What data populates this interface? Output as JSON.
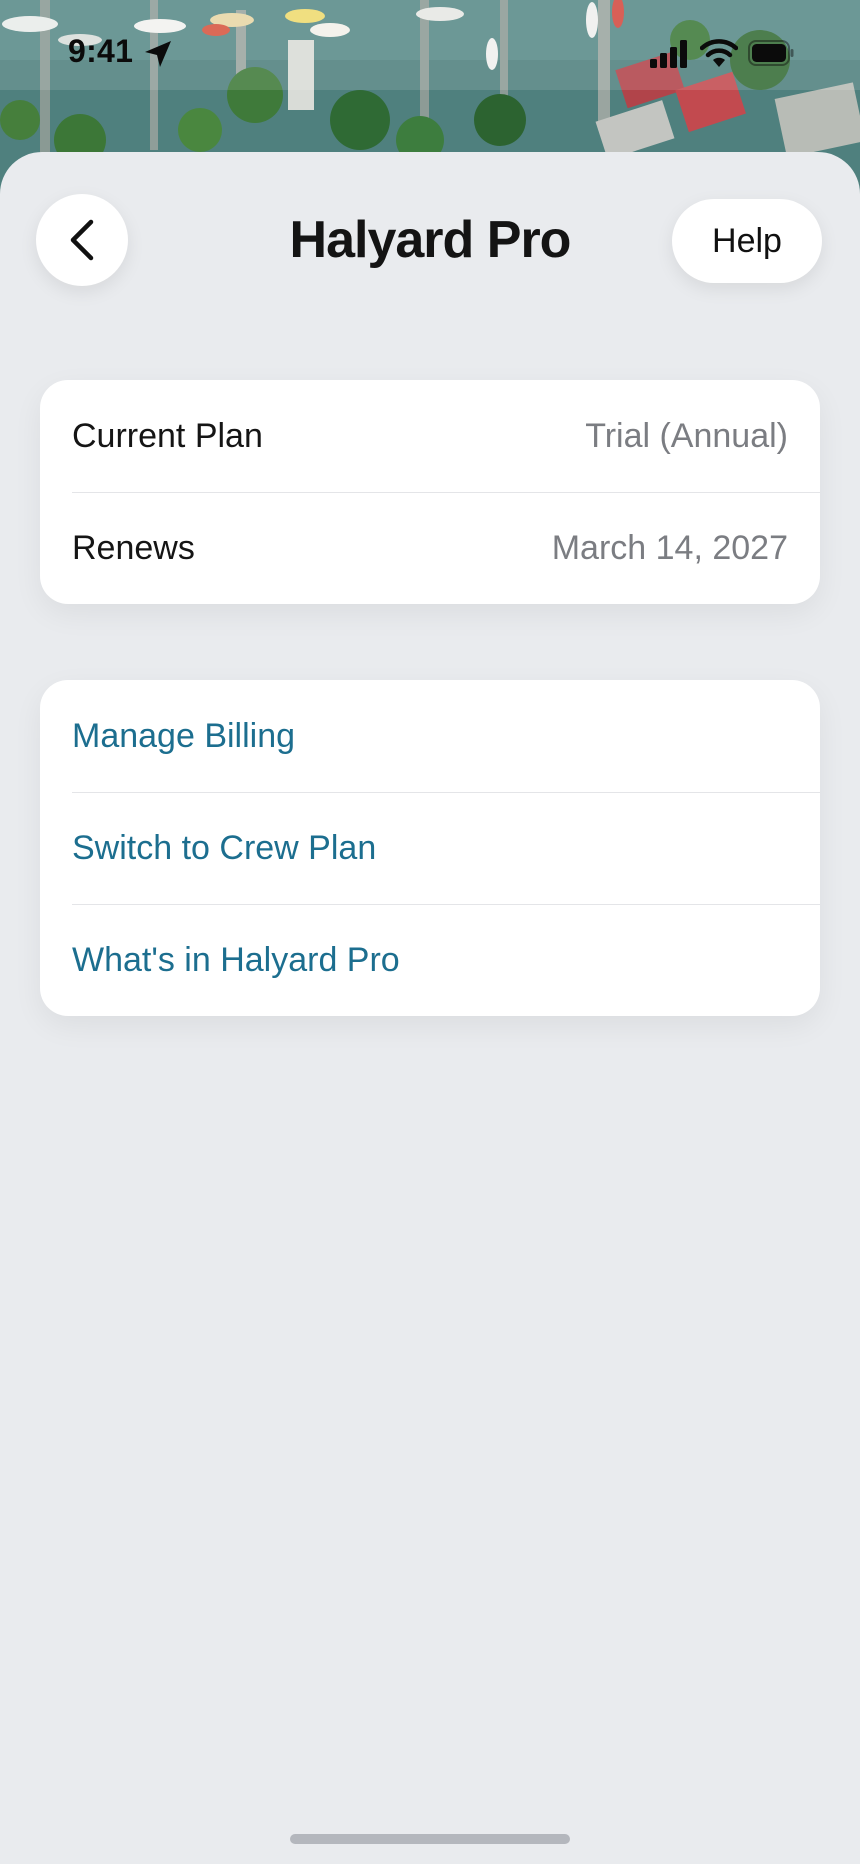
{
  "status_bar": {
    "time": "9:41",
    "icons": [
      "location-arrow-icon",
      "cellular-signal-icon",
      "wifi-icon",
      "battery-icon"
    ]
  },
  "header": {
    "title": "Halyard Pro",
    "back_icon": "chevron-left-icon",
    "help_label": "Help"
  },
  "plan": {
    "rows": [
      {
        "label": "Current Plan",
        "value": "Trial (Annual)"
      },
      {
        "label": "Renews",
        "value": "March 14, 2027"
      }
    ]
  },
  "actions": {
    "items": [
      {
        "label": "Manage Billing"
      },
      {
        "label": "Switch to Crew Plan"
      },
      {
        "label": "What's in Halyard Pro"
      }
    ]
  },
  "colors": {
    "background": "#e9ebee",
    "card": "#ffffff",
    "link": "#1c6e8f",
    "secondary_text": "#7b7d82",
    "primary_text": "#151515"
  }
}
